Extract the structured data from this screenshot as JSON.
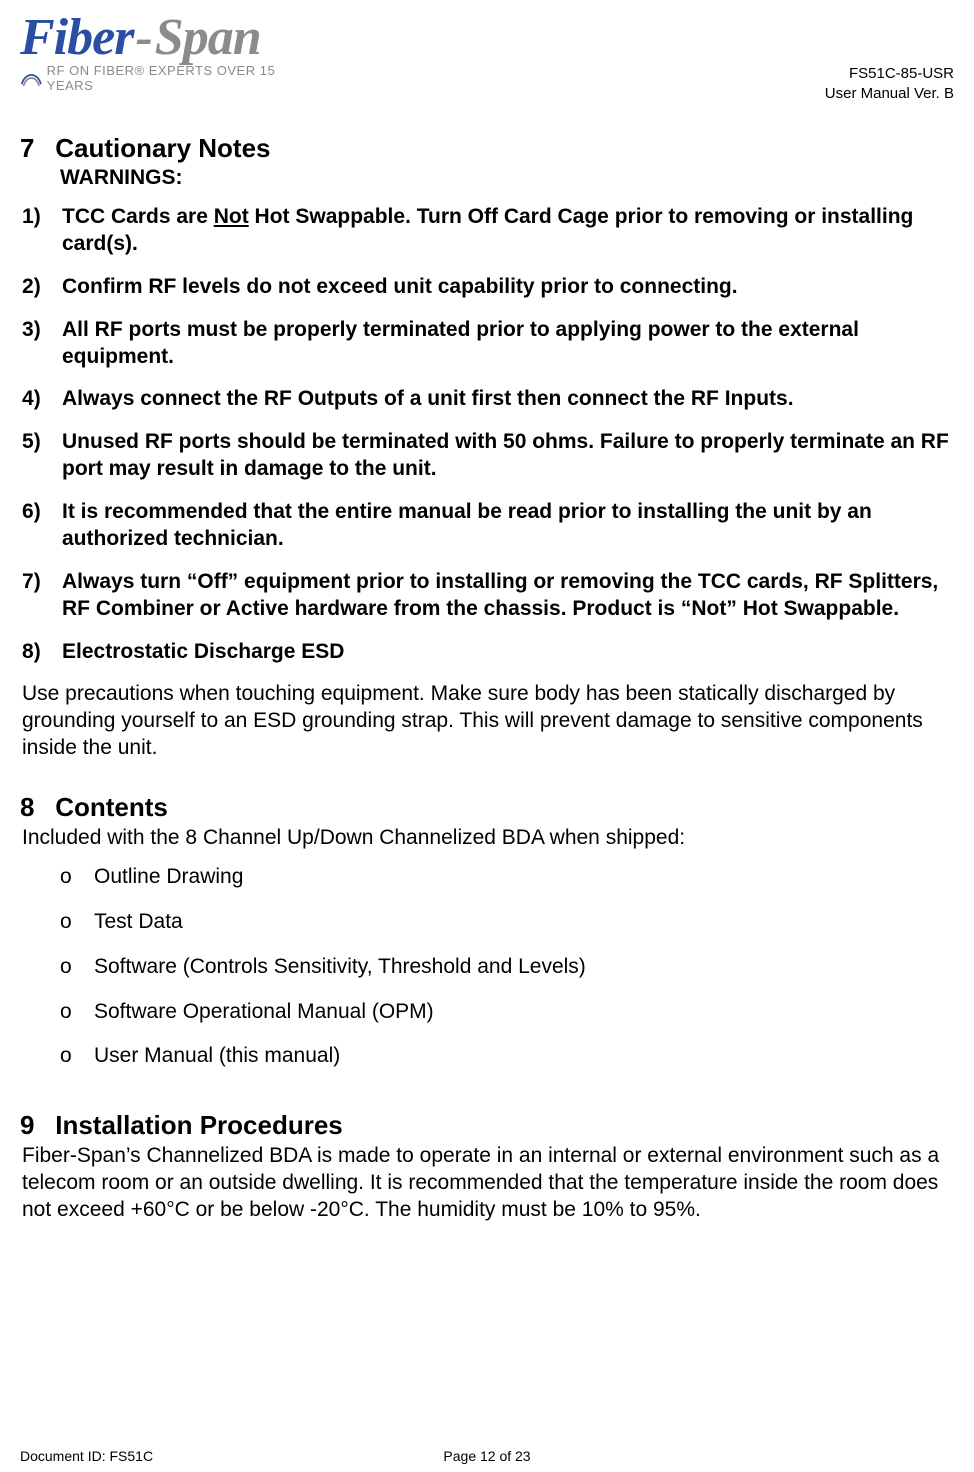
{
  "header": {
    "logo_fiber": "Fiber",
    "logo_dash": "-",
    "logo_span": "Span",
    "logo_tagline": "RF ON FIBER® EXPERTS OVER 15 YEARS",
    "doc_code": "FS51C-85-USR",
    "doc_version": "User Manual Ver. B"
  },
  "sections": {
    "s7": {
      "num": "7",
      "title": "Cautionary Notes",
      "subtitle": "WARNINGS:"
    },
    "s8": {
      "num": "8",
      "title": "Contents",
      "intro": "Included with the 8 Channel Up/Down Channelized BDA when shipped:"
    },
    "s9": {
      "num": "9",
      "title": "Installation Procedures"
    }
  },
  "warnings": {
    "w1_a": "TCC Cards are ",
    "w1_not": "Not",
    "w1_b": " Hot Swappable. Turn Off Card Cage prior to removing or installing card(s).",
    "w2": "Confirm RF levels do not exceed unit capability prior to connecting.",
    "w3": "All RF ports must be properly terminated prior to applying power to the external equipment.",
    "w4": "Always connect the RF Outputs of a unit first then connect the RF Inputs.",
    "w5": "Unused RF ports should be terminated with 50 ohms. Failure to properly terminate an RF port may result in damage to the unit.",
    "w6": "It is recommended that the entire manual be read prior to installing the unit by an authorized technician.",
    "w7": "Always turn “Off” equipment prior to installing or removing the TCC cards, RF Splitters, RF Combiner or Active hardware from the chassis.  Product is “Not” Hot Swappable.",
    "w8": "Electrostatic Discharge ESD"
  },
  "esd_para": "Use precautions when touching equipment.  Make sure body has been statically discharged by grounding yourself to an ESD grounding strap.  This will prevent damage to sensitive components inside the unit.",
  "contents_items": {
    "c1": "Outline Drawing",
    "c2": "Test Data",
    "c3": "Software (Controls Sensitivity, Threshold and Levels)",
    "c4": "Software Operational  Manual (OPM)",
    "c5": "User Manual (this manual)"
  },
  "install_para": "Fiber-Span’s Channelized BDA is made to operate in an internal or external environment such as a telecom room or an outside dwelling.  It is recommended that the temperature inside the room does not exceed +60°C or be below -20°C.  The humidity must be 10% to 95%.",
  "footer": {
    "left": "Document ID: FS51C",
    "center": "Page 12 of 23"
  }
}
